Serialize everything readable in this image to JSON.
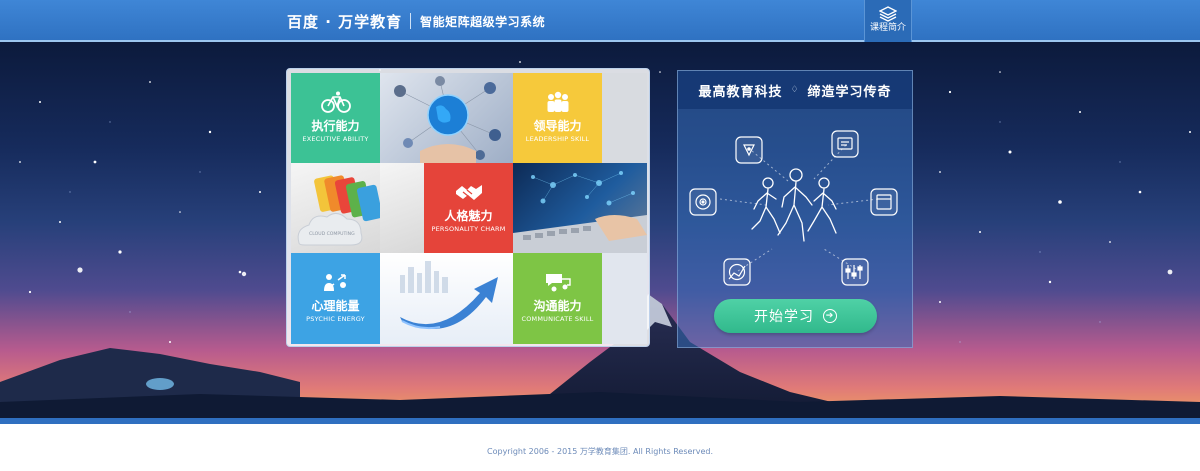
{
  "header": {
    "brand_name": "百度 · 万学教育",
    "brand_tagline": "智能矩阵超级学习系统",
    "course_button_label": "课程简介"
  },
  "tiles": [
    {
      "cn": "执行能力",
      "en": "EXECUTIVE ABILITY",
      "color": "#3cc295",
      "icon": "bicycle-icon"
    },
    {
      "cn": "领导能力",
      "en": "LEADERSHIP SKILL",
      "color": "#f6c93b",
      "icon": "team-icon"
    },
    {
      "cn": "人格魅力",
      "en": "PERSONALITY CHARM",
      "color": "#e5443a",
      "icon": "handshake-icon"
    },
    {
      "cn": "心理能量",
      "en": "PSYCHIC ENERGY",
      "color": "#3da3e4",
      "icon": "exchange-icon"
    },
    {
      "cn": "沟通能力",
      "en": "COMMUNICATE SKILL",
      "color": "#7ec545",
      "icon": "chat-icon"
    }
  ],
  "cloud_text": "CLOUD COMPUTING",
  "panel": {
    "title_left": "最高教育科技",
    "title_right": "缔造学习传奇",
    "diamond": "♢",
    "start_label": "开始学习",
    "start_arrow": "➔"
  },
  "footer": {
    "copyright": "Copyright 2006 - 2015 万学教育集团. All Rights Reserved."
  },
  "colors": {
    "header": "#3479c9",
    "accent_green": "#3cc295",
    "button_green": "#3fc598"
  }
}
